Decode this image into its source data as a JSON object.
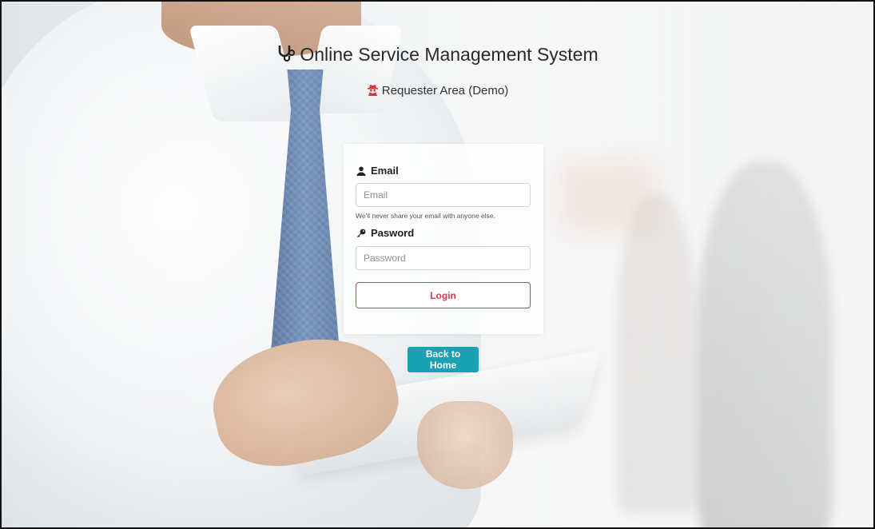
{
  "header": {
    "title": "Online Service Management System",
    "subtitle": "Requester Area (Demo)"
  },
  "form": {
    "email_label": "Email",
    "email_placeholder": "Email",
    "email_value": "",
    "email_help": "We'll never share your email with anyone else.",
    "password_label": "Pasword",
    "password_placeholder": "Password",
    "password_value": "",
    "login_label": "Login"
  },
  "nav": {
    "back_home_label": "Back to Home"
  },
  "icons": {
    "logo": "stethoscope-icon",
    "area": "user-secret-icon",
    "email": "user-icon",
    "password": "key-icon"
  },
  "colors": {
    "login_border": "#d43a4a",
    "back_home_bg": "#1aa2b4",
    "area_icon": "#d9363e"
  }
}
